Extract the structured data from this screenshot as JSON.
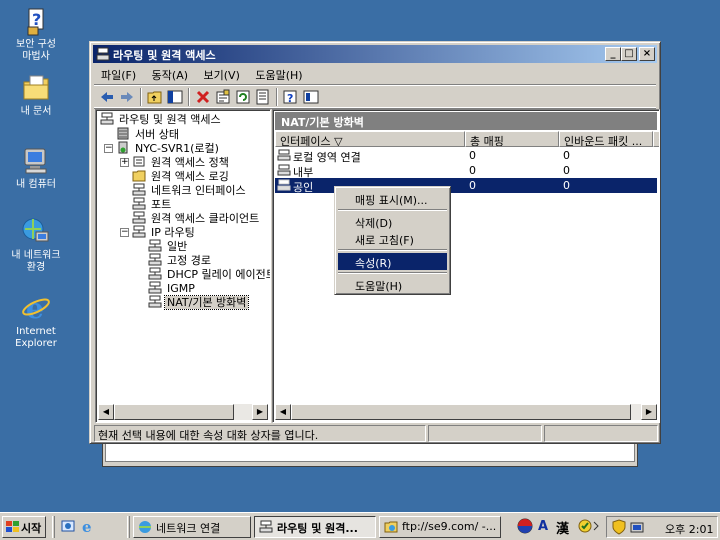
{
  "desktop": {
    "icons": [
      {
        "label": "보안 구성\n마법사",
        "icon": "security-wizard-icon"
      },
      {
        "label": "내 문서",
        "icon": "my-documents-icon"
      },
      {
        "label": "내 컴퓨터",
        "icon": "my-computer-icon"
      },
      {
        "label": "내 네트워크\n환경",
        "icon": "my-network-icon"
      },
      {
        "label": "Internet\nExplorer",
        "icon": "internet-explorer-icon"
      }
    ]
  },
  "window": {
    "title": "라우팅 및 원격 액세스",
    "menu": [
      "파일(F)",
      "동작(A)",
      "보기(V)",
      "도움말(H)"
    ],
    "tree": {
      "root": "라우팅 및 원격 액세스",
      "items": [
        "서버 상태",
        "NYC-SVR1(로컬)",
        "원격 액세스 정책",
        "원격 액세스 로깅",
        "네트워크 인터페이스",
        "포트",
        "원격 액세스 클라이언트",
        "IP 라우팅",
        "일반",
        "고정 경로",
        "DHCP 릴레이 에이전트",
        "IGMP",
        "NAT/기본 방화벽"
      ]
    },
    "right_pane": {
      "header": "NAT/기본 방화벽",
      "columns": [
        "인터페이스 ▽",
        "총 매핑",
        "인바운드 패킷 ...",
        "("
      ],
      "rows": [
        {
          "name": "로컬 영역 연결",
          "mappings": "0",
          "inbound": "0"
        },
        {
          "name": "내부",
          "mappings": "0",
          "inbound": "0"
        },
        {
          "name": "공인",
          "mappings": "0",
          "inbound": "0"
        }
      ]
    },
    "status": "현재 선택 내용에 대한 속성 대화 상자를 엽니다."
  },
  "context_menu": {
    "items": [
      "매핑 표시(M)...",
      "삭제(D)",
      "새로 고침(F)",
      "속성(R)",
      "도움말(H)"
    ],
    "highlighted": "속성(R)"
  },
  "taskbar": {
    "start": "시작",
    "tasks": [
      "네트워크 연결",
      "라우팅 및 원격...",
      "ftp://se9.com/ -..."
    ],
    "active_task": "라우팅 및 원격...",
    "clock": "오후 2:01",
    "ime": [
      "A",
      "漢"
    ]
  },
  "colors": {
    "desktop": "#3a6ea5",
    "title_active": "#0a246a",
    "selection": "#0a246a",
    "face": "#d4d0c8"
  }
}
